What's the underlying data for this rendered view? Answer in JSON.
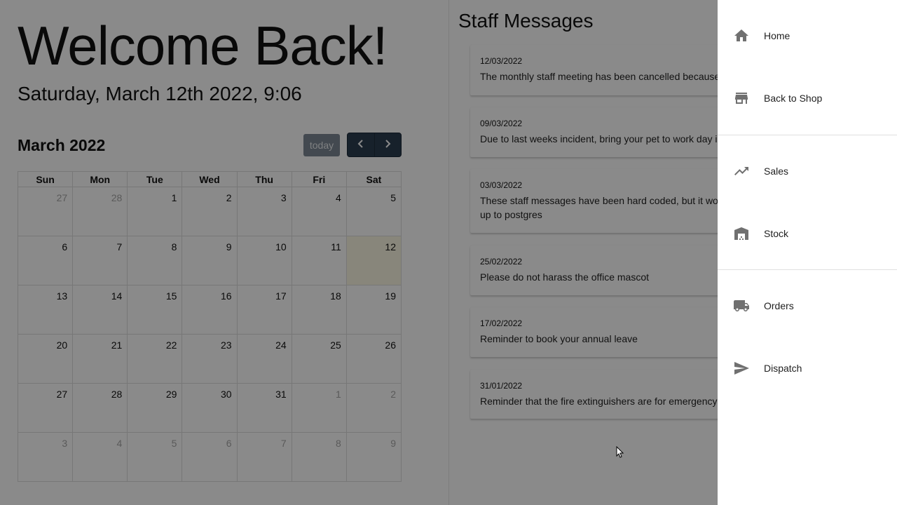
{
  "welcome": {
    "title": "Welcome Back!",
    "datetime": "Saturday, March 12th 2022, 9:06"
  },
  "calendar": {
    "month_title": "March 2022",
    "today_label": "today",
    "prev_icon": "chevron-left-icon",
    "next_icon": "chevron-right-icon",
    "weekdays": [
      "Sun",
      "Mon",
      "Tue",
      "Wed",
      "Thu",
      "Fri",
      "Sat"
    ],
    "weeks": [
      [
        "27",
        "28",
        "1",
        "2",
        "3",
        "4",
        "5"
      ],
      [
        "6",
        "7",
        "8",
        "9",
        "10",
        "11",
        "12"
      ],
      [
        "13",
        "14",
        "15",
        "16",
        "17",
        "18",
        "19"
      ],
      [
        "20",
        "21",
        "22",
        "23",
        "24",
        "25",
        "26"
      ],
      [
        "27",
        "28",
        "29",
        "30",
        "31",
        "1",
        "2"
      ],
      [
        "3",
        "4",
        "5",
        "6",
        "7",
        "8",
        "9"
      ]
    ],
    "today": "12"
  },
  "messages": {
    "title": "Staff Messages",
    "items": [
      {
        "date": "12/03/2022",
        "text": "The monthly staff meeting has been cancelled because r"
      },
      {
        "date": "09/03/2022",
        "text": "Due to last weeks incident, bring your pet to work day is c"
      },
      {
        "date": "03/03/2022",
        "text": "These staff messages have been hard coded, but it woul",
        "text2": "up to postgres"
      },
      {
        "date": "25/02/2022",
        "text": "Please do not harass the office mascot"
      },
      {
        "date": "17/02/2022",
        "text": "Reminder to book your annual leave"
      },
      {
        "date": "31/01/2022",
        "text": "Reminder that the fire extinguishers are for emergency u"
      }
    ]
  },
  "drawer": {
    "items": [
      {
        "label": "Home",
        "icon": "home-icon"
      },
      {
        "label": "Back to Shop",
        "icon": "store-icon"
      },
      {
        "label": "Sales",
        "icon": "trending-up-icon"
      },
      {
        "label": "Stock",
        "icon": "warehouse-icon"
      },
      {
        "label": "Orders",
        "icon": "truck-icon"
      },
      {
        "label": "Dispatch",
        "icon": "send-icon"
      }
    ]
  },
  "colors": {
    "overlay": "#000000",
    "nav_button": "#2c3e50",
    "today_button": "#7d8794",
    "today_cell": "#fcf8e3"
  }
}
